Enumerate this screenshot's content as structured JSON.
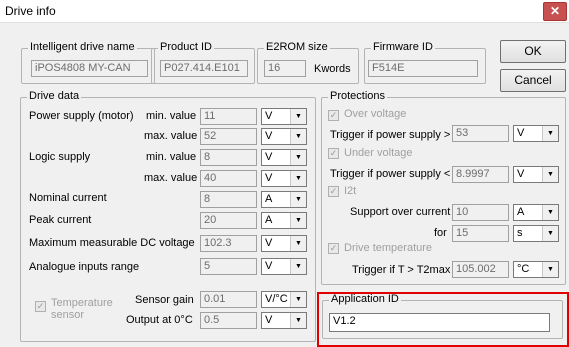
{
  "window": {
    "title": "Drive info",
    "close_glyph": "✕"
  },
  "header": {
    "drive_name_label": "Intelligent drive name",
    "drive_name_value": "iPOS4808 MY-CAN",
    "product_id_label": "Product ID",
    "product_id_value": "P027.414.E101",
    "e2rom_label": "E2ROM size",
    "e2rom_value": "16",
    "e2rom_unit": "Kwords",
    "firmware_label": "Firmware ID",
    "firmware_value": "F514E"
  },
  "buttons": {
    "ok": "OK",
    "cancel": "Cancel"
  },
  "drive_data": {
    "title": "Drive data",
    "power_supply_label": "Power supply (motor)",
    "min_label": "min. value",
    "max_label": "max. value",
    "power_min": "11",
    "power_min_unit": "V",
    "power_max": "52",
    "power_max_unit": "V",
    "logic_supply_label": "Logic supply",
    "logic_min": "8",
    "logic_min_unit": "V",
    "logic_max": "40",
    "logic_max_unit": "V",
    "nominal_current_label": "Nominal current",
    "nominal_current": "8",
    "nominal_current_unit": "A",
    "peak_current_label": "Peak current",
    "peak_current": "20",
    "peak_current_unit": "A",
    "max_dc_label": "Maximum measurable DC voltage",
    "max_dc": "102.3",
    "max_dc_unit": "V",
    "analogue_label": "Analogue inputs range",
    "analogue": "5",
    "analogue_unit": "V",
    "temp_sensor_label": "Temperature sensor",
    "sensor_gain_label": "Sensor gain",
    "sensor_gain": "0.01",
    "sensor_gain_unit": "V/°C",
    "output0_label": "Output at 0°C",
    "output0": "0.5",
    "output0_unit": "V"
  },
  "protections": {
    "title": "Protections",
    "over_voltage_label": "Over voltage",
    "trigger_over_label": "Trigger if power supply >",
    "trigger_over": "53",
    "trigger_over_unit": "V",
    "under_voltage_label": "Under voltage",
    "trigger_under_label": "Trigger if power supply <",
    "trigger_under": "8.9997",
    "trigger_under_unit": "V",
    "i2t_label": "I2t",
    "support_over_label": "Support over current",
    "support_over": "10",
    "support_over_unit": "A",
    "for_label": "for",
    "for_value": "15",
    "for_unit": "s",
    "drive_temp_label": "Drive temperature",
    "trigger_temp_label": "Trigger if T > T2max",
    "trigger_temp": "105.002",
    "trigger_temp_unit": "°C"
  },
  "application": {
    "label": "Application ID",
    "value": "V1.2"
  },
  "colors": {
    "highlight": "#e00000",
    "window_bg": "#f0f0f0"
  }
}
